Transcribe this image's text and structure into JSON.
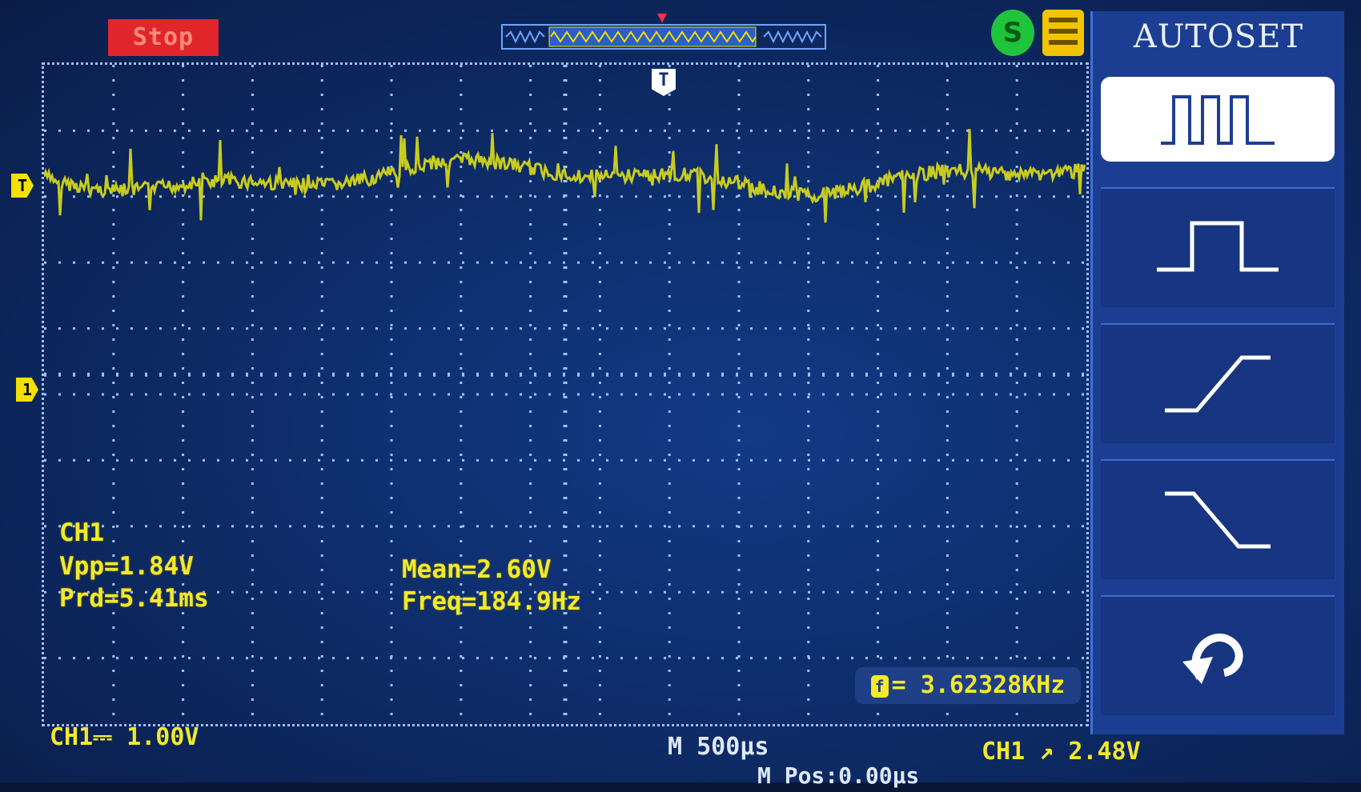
{
  "status": {
    "run_state": "Stop"
  },
  "channel_markers": {
    "trigger_level": "T",
    "ch1_ground": "1",
    "trigger_position": "T"
  },
  "measurements": {
    "channel": "CH1",
    "vpp": "Vpp=1.84V",
    "prd": "Prd=5.41ms",
    "mean": "Mean=2.60V",
    "freq": "Freq=184.9Hz"
  },
  "frequency_counter": {
    "icon": "f",
    "value": "= 3.62328KHz"
  },
  "bottom_bar": {
    "ch1_scale": "CH1⎓ 1.00V",
    "timebase": "M 500µs",
    "trigger": "CH1 ↗ 2.48V",
    "position": "M Pos:0.00µs"
  },
  "menu": {
    "title": "AUTOSET",
    "items": [
      {
        "icon": "multi-period-icon",
        "selected": true
      },
      {
        "icon": "single-pulse-icon",
        "selected": false
      },
      {
        "icon": "rising-edge-icon",
        "selected": false
      },
      {
        "icon": "falling-edge-icon",
        "selected": false
      },
      {
        "icon": "undo-icon",
        "selected": false
      }
    ]
  },
  "colors": {
    "trace": "#c8cc1e",
    "grid": "#9cc2ff",
    "text": "#f2ea2a",
    "stop": "#e0262b"
  }
}
